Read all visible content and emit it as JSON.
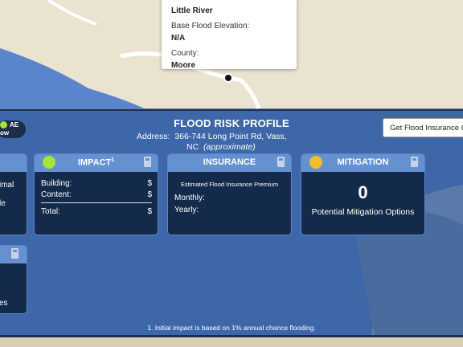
{
  "popup": {
    "name": "Little River",
    "bfe_label": "Base Flood Elevation:",
    "bfe_value": "N/A",
    "county_label": "County:",
    "county_value": "Moore"
  },
  "panel": {
    "title": "FLOOD RISK PROFILE",
    "address_label": "Address:",
    "address_line1": "366-744 Long Point Rd, Vass,",
    "address_line2": "NC",
    "address_note": "(approximate)",
    "insurance_button": "Get Flood Insurance Quote",
    "toggle_top": "AE",
    "toggle_bottom": "ow",
    "footnote": "1. Initial impact is based on 1% annual chance flooding."
  },
  "left_cards": {
    "a_line1": "imal",
    "a_line2": "le",
    "b_line1": "es"
  },
  "impact": {
    "title": "IMPACT",
    "sup": "1",
    "building_label": "Building:",
    "building_value": "$",
    "content_label": "Content:",
    "content_value": "$",
    "total_label": "Total:",
    "total_value": "$",
    "status_color": "#a8e23c"
  },
  "insurance": {
    "title": "INSURANCE",
    "premium_label": "Estimated Flood Insurance Premium",
    "monthly_label": "Monthly:",
    "yearly_label": "Yearly:"
  },
  "mitigation": {
    "title": "MITIGATION",
    "count": "0",
    "label": "Potential Mitigation Options",
    "status_color": "#f0be2a"
  },
  "colors": {
    "water": "#5a85cc",
    "land": "#e9e3cf",
    "panel": "#365fa0",
    "card_bg": "#142a4a",
    "card_head": "#6691d1"
  }
}
